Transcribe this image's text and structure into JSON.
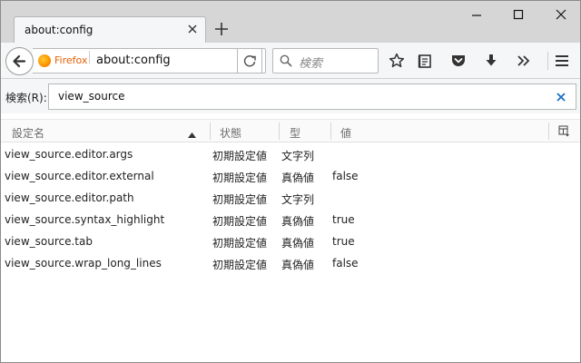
{
  "window": {
    "tab_title": "about:config",
    "controls": [
      "minimize-icon",
      "maximize-icon",
      "close-icon"
    ]
  },
  "navbar": {
    "identity_label": "Firefox",
    "url": "about:config",
    "search_placeholder": "検索"
  },
  "filter": {
    "label": "検索(R):",
    "value": "view_source"
  },
  "table": {
    "columns": [
      "設定名",
      "状態",
      "型",
      "値"
    ],
    "sorted_column": "設定名",
    "sort_direction": "ascending",
    "rows": [
      {
        "name": "view_source.editor.args",
        "status": "初期設定値",
        "type": "文字列",
        "value": ""
      },
      {
        "name": "view_source.editor.external",
        "status": "初期設定値",
        "type": "真偽値",
        "value": "false"
      },
      {
        "name": "view_source.editor.path",
        "status": "初期設定値",
        "type": "文字列",
        "value": ""
      },
      {
        "name": "view_source.syntax_highlight",
        "status": "初期設定値",
        "type": "真偽値",
        "value": "true"
      },
      {
        "name": "view_source.tab",
        "status": "初期設定値",
        "type": "真偽値",
        "value": "true"
      },
      {
        "name": "view_source.wrap_long_lines",
        "status": "初期設定値",
        "type": "真偽値",
        "value": "false"
      }
    ]
  },
  "colors": {
    "tabstrip": "#d6d6d6",
    "toolbar": "#f5f6f7",
    "identity": "#e66000"
  }
}
